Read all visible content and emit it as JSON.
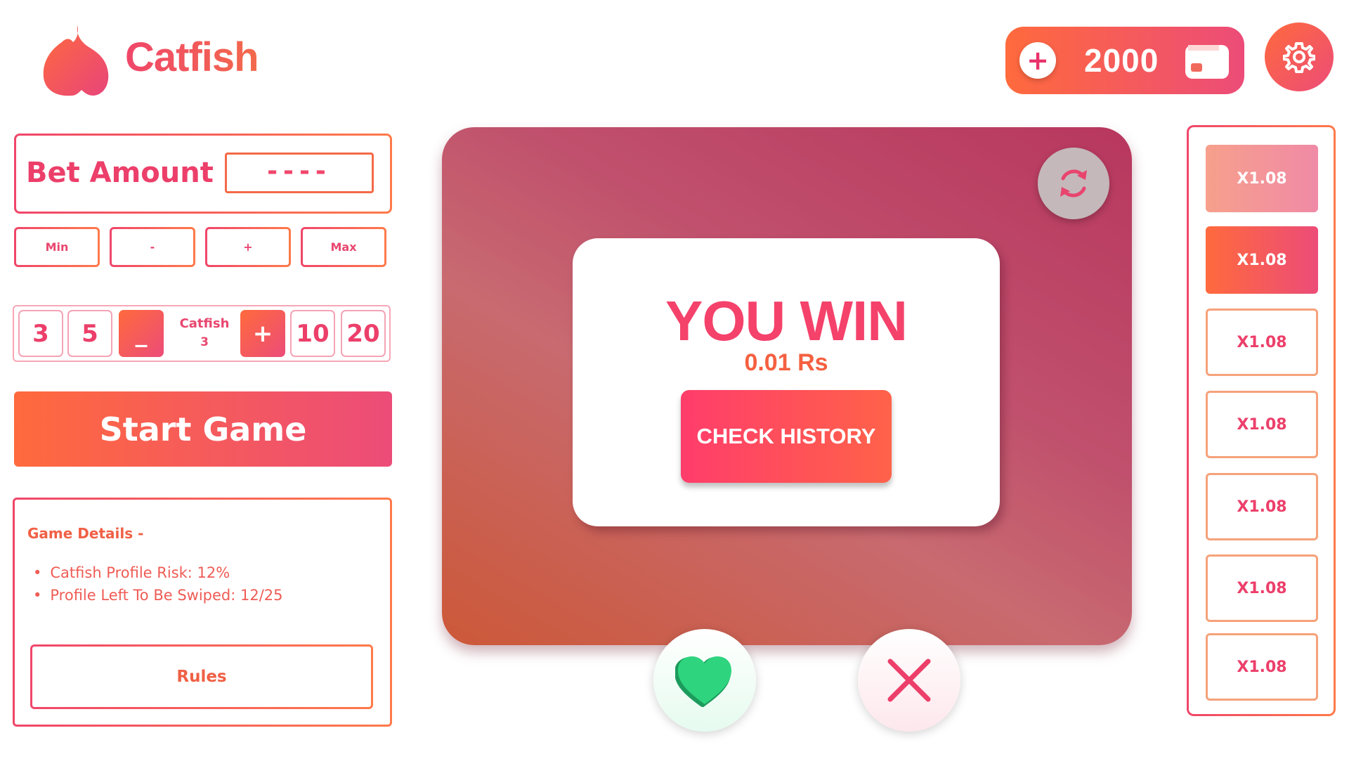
{
  "header": {
    "brand": "Catfish",
    "wallet": {
      "plus_label": "+",
      "balance": "2000"
    }
  },
  "bet": {
    "label": "Bet Amount",
    "value": "----"
  },
  "chips": [
    "Min",
    "-",
    "+",
    "Max"
  ],
  "catfish_selector": {
    "options_left": [
      "3",
      "5"
    ],
    "minus_label": "_",
    "title": "Catfish",
    "value": "3",
    "plus_label": "+",
    "options_right": [
      "10",
      "20"
    ]
  },
  "start_button": "Start Game",
  "details": {
    "title": "Game Details -",
    "items": [
      "Catfish Profile Risk: 12%",
      "Profile Left To Be Swiped: 12/25"
    ],
    "rules_label": "Rules"
  },
  "result": {
    "title": "YOU WIN",
    "amount": "0.01 Rs",
    "history_button": "CHECK HISTORY"
  },
  "multipliers": [
    "X1.08",
    "X1.08",
    "X1.08",
    "X1.08",
    "X1.08",
    "X1.08",
    "X1.08"
  ],
  "colors": {
    "accent_orange": "#ff6a3d",
    "accent_pink": "#ec4c78",
    "like_green": "#2fd47e",
    "nope_red": "#ec3f6a"
  }
}
